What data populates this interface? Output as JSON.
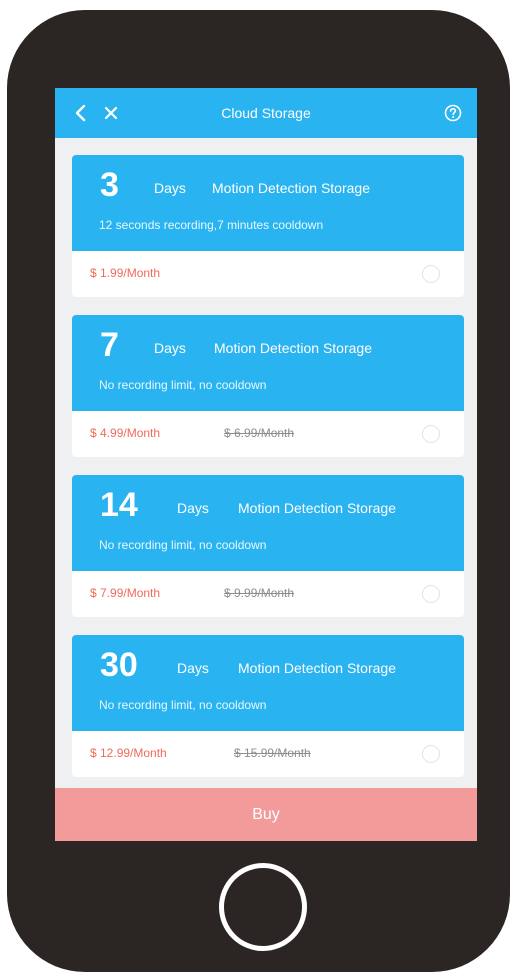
{
  "header": {
    "title": "Cloud Storage",
    "back_icon": "chevron-left-icon",
    "close_icon": "close-icon",
    "help_icon": "help-circle-icon"
  },
  "plans": [
    {
      "days": "3",
      "days_word": "Days",
      "storage_type": "Motion Detection Storage",
      "description": "12 seconds recording,7 minutes cooldown",
      "price": "$ 1.99/Month",
      "original_price": ""
    },
    {
      "days": "7",
      "days_word": "Days",
      "storage_type": "Motion Detection Storage",
      "description": "No recording limit, no cooldown",
      "price": "$ 4.99/Month",
      "original_price": "$ 6.99/Month"
    },
    {
      "days": "14",
      "days_word": "Days",
      "storage_type": "Motion Detection Storage",
      "description": "No recording limit, no cooldown",
      "price": "$ 7.99/Month",
      "original_price": "$ 9.99/Month"
    },
    {
      "days": "30",
      "days_word": "Days",
      "storage_type": "Motion Detection Storage",
      "description": "No recording limit, no cooldown",
      "price": "$ 12.99/Month",
      "original_price": "$ 15.99/Month"
    }
  ],
  "footer": {
    "buy_label": "Buy"
  },
  "colors": {
    "accent": "#29b3f0",
    "price": "#f06a5a",
    "buy_button": "#f39a9a",
    "phone_body": "#2b2524"
  }
}
